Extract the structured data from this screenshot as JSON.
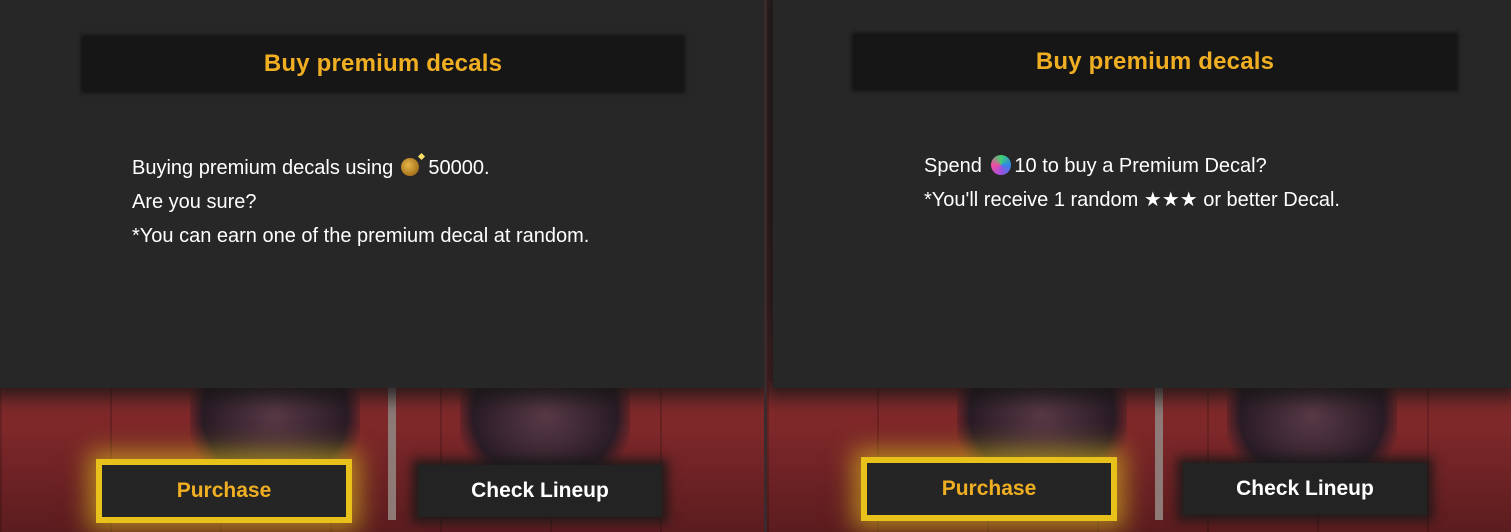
{
  "panels": [
    {
      "title": "Buy premium decals",
      "lines": [
        {
          "pre": "Buying premium decals using ",
          "icon": "coin-icon",
          "post": " 50000."
        },
        {
          "text": "Are you sure?"
        },
        {
          "text": "*You can earn one of the premium decal at random."
        }
      ],
      "purchase_label": "Purchase",
      "lineup_label": "Check Lineup"
    },
    {
      "title": "Buy premium decals",
      "lines": [
        {
          "pre": "Spend ",
          "icon": "gem-icon",
          "post": "10 to buy a Premium Decal?"
        },
        {
          "text": "*You'll receive 1 random ★★★ or better Decal."
        }
      ],
      "purchase_label": "Purchase",
      "lineup_label": "Check Lineup"
    }
  ],
  "colors": {
    "accent": "#f0ae22",
    "highlight": "#e8c21a",
    "dialog": "#272727"
  }
}
